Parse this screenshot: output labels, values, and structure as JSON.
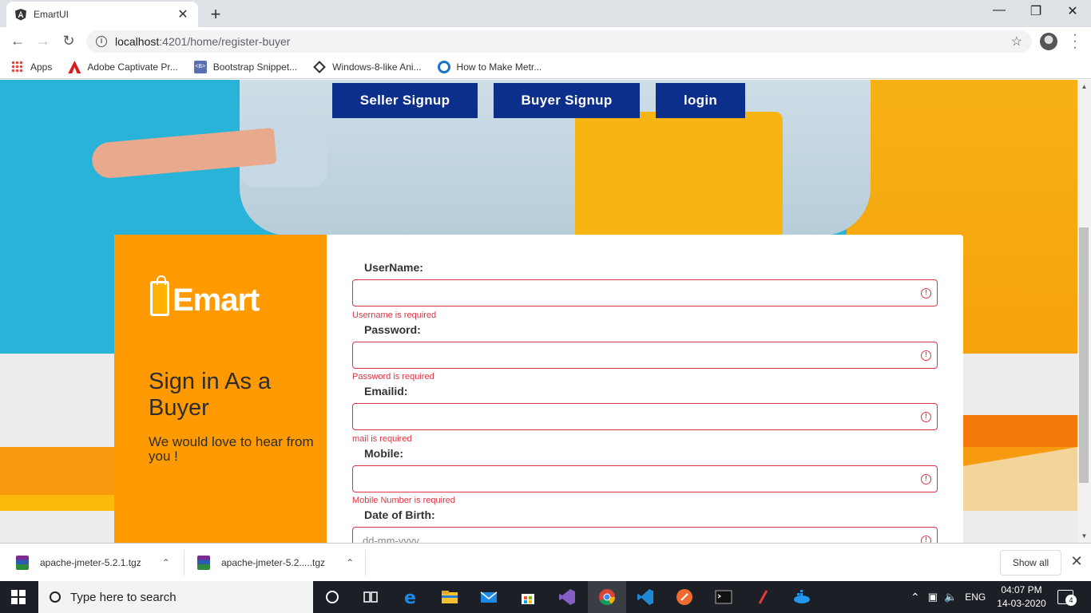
{
  "browser": {
    "tab_title": "EmartUI",
    "new_tab_symbol": "+",
    "close_symbol": "✕",
    "url_host": "localhost",
    "url_path": ":4201/home/register-buyer",
    "bookmarks": [
      {
        "label": "Apps",
        "icon": "apps-grid-icon"
      },
      {
        "label": "Adobe Captivate Pr...",
        "icon": "adobe-icon"
      },
      {
        "label": "Bootstrap Snippet...",
        "icon": "bootstrap-icon"
      },
      {
        "label": "Windows-8-like Ani...",
        "icon": "windows-diamond-icon"
      },
      {
        "label": "How to Make Metr...",
        "icon": "metro-c-icon"
      }
    ]
  },
  "nav": {
    "seller_signup": "Seller Signup",
    "buyer_signup": "Buyer Signup",
    "login": "login"
  },
  "left_panel": {
    "logo_text": "Emart",
    "title": "Sign in As a Buyer",
    "subtitle": "We would love to hear from you !"
  },
  "form": {
    "fields": [
      {
        "label": "UserName:",
        "error": "Username is required",
        "placeholder": ""
      },
      {
        "label": "Password:",
        "error": "Password is required",
        "placeholder": ""
      },
      {
        "label": "Emailid:",
        "error": "mail is required",
        "placeholder": ""
      },
      {
        "label": "Mobile:",
        "error": "Mobile Number is required",
        "placeholder": ""
      },
      {
        "label": "Date of Birth:",
        "placeholder": "dd-mm-yyyy"
      }
    ]
  },
  "downloads": {
    "items": [
      {
        "name": "apache-jmeter-5.2.1.tgz"
      },
      {
        "name": "apache-jmeter-5.2.....tgz"
      }
    ],
    "show_all": "Show all"
  },
  "taskbar": {
    "search_placeholder": "Type here to search",
    "language": "ENG",
    "time": "04:07 PM",
    "date": "14-03-2020",
    "notification_count": "4"
  },
  "colors": {
    "accent_button": "#0d2f8c",
    "panel_orange": "#ff9a00",
    "error_red": "#dc3545",
    "hero_blue": "#29b3d8"
  }
}
